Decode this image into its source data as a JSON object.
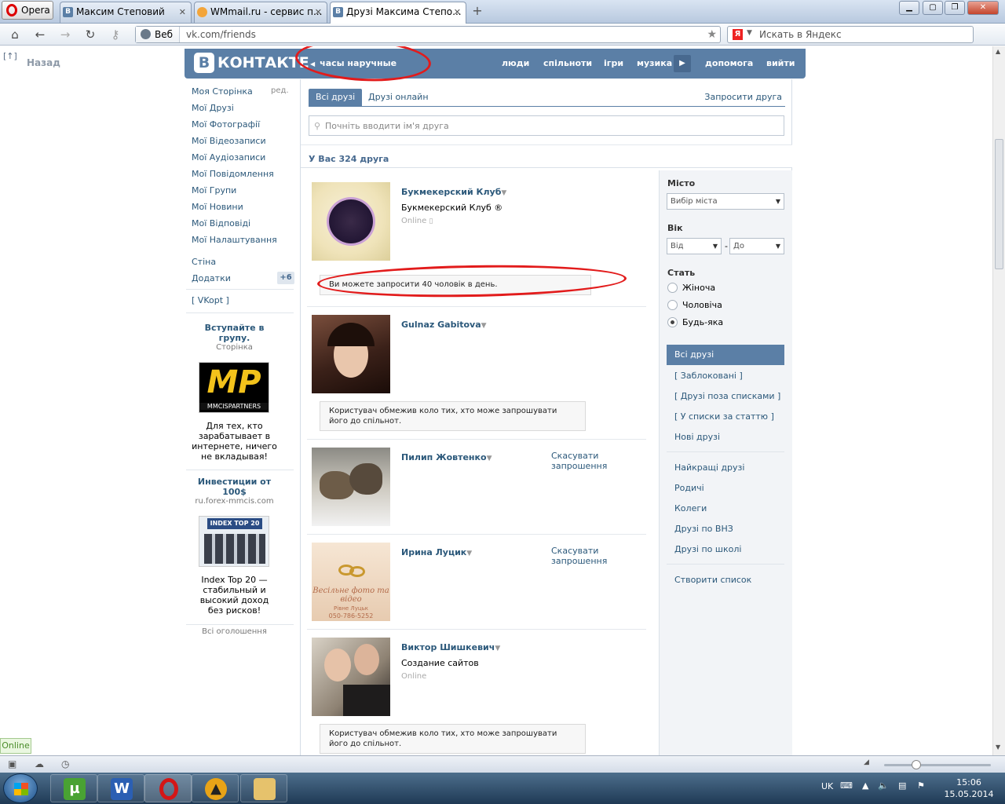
{
  "browser": {
    "opera_label": "Opera",
    "tabs": [
      {
        "label": "Максим Степовий"
      },
      {
        "label": "WMmail.ru - сервис п..."
      },
      {
        "label": "Друзі Максима Степо..."
      }
    ],
    "web_label": "Веб",
    "url": "vk.com/friends",
    "search_placeholder": "Искать в Яндекс",
    "back_label": "Назад",
    "back_icon_label": "[↑]"
  },
  "vk": {
    "logo_letter": "В",
    "logo_text": "КОНТАКТЕ",
    "header_search": "часы наручные",
    "nav": [
      "люди",
      "спільноти",
      "ігри",
      "музика",
      "допомога",
      "вийти"
    ],
    "left_menu": [
      "Моя Сторінка",
      "Мої Друзі",
      "Мої Фотографії",
      "Мої Відеозаписи",
      "Мої Аудіозаписи",
      "Мої Повідомлення",
      "Мої Групи",
      "Мої Новини",
      "Мої Відповіді",
      "Мої Налаштування"
    ],
    "edit_label": "ред.",
    "wall_label": "Стіна",
    "apps_label": "Додатки",
    "apps_badge": "+6",
    "vkopt_label": "[ VKopt ]",
    "ads": [
      {
        "title": "Вступайте в групу.",
        "subtitle": "Сторінка",
        "image_text": "MP",
        "image_caption": "MMCISPARTNERS",
        "desc": "Для тех, кто зарабатывает в интернете, ничего не вкладывая!"
      },
      {
        "title": "Инвестиции от 100$",
        "subtitle": "ru.forex-mmcis.com",
        "image_text": "INDEX TOP 20",
        "desc": "Index Top 20 — стабильный и высокий доход без рисков!"
      }
    ],
    "ads_all": "Всі оголошення",
    "tabs": [
      "Всі друзі",
      "Друзі онлайн"
    ],
    "invite_friend": "Запросити друга",
    "friend_search_placeholder": "Почніть вводити ім'я друга",
    "friends_count": "У Вас 324 друга",
    "friends": [
      {
        "name": "Букмекерский Клуб",
        "sub": "Букмекерский Клуб ®",
        "online": "Online"
      },
      {
        "name": "Gulnaz Gabitova"
      },
      {
        "name": "Пилип Жовтенко",
        "cancel": "Скасувати запрошення"
      },
      {
        "name": "Ирина Луцик",
        "cancel": "Скасувати запрошення",
        "photo_text": "Весільне фото та відео",
        "photo_sub": "Рівне Луцьк",
        "photo_phone": "050-786-5252"
      },
      {
        "name": "Виктор Шишкевич",
        "sub": "Создание сайтов",
        "online": "Online"
      }
    ],
    "notice_limit": "Ви можете запросити 40 чоловік в день.",
    "notice_restricted": "Користувач обмежив коло тих, хто може запрошувати його до спільнот.",
    "filters": {
      "city_label": "Місто",
      "city_placeholder": "Вибір міста",
      "age_label": "Вік",
      "age_from": "Від",
      "age_to": "До",
      "age_dash": "-",
      "gender_label": "Стать",
      "genders": [
        "Жіноча",
        "Чоловіча",
        "Будь-яка"
      ],
      "lists": [
        "Всі друзі",
        "[ Заблоковані ]",
        "[ Друзі поза списками ]",
        "[ У списки за статтю ]",
        "Нові друзі"
      ],
      "groups": [
        "Найкращі друзі",
        "Родичі",
        "Колеги",
        "Друзі по ВНЗ",
        "Друзі по школі"
      ],
      "create_list": "Створити список"
    }
  },
  "status": {
    "online": "Online"
  },
  "taskbar": {
    "lang": "UK",
    "time": "15:06",
    "date": "15.05.2014"
  },
  "colors": {
    "vk_blue": "#5b7fa6",
    "link": "#2b587a",
    "annotation": "#e21b1b"
  }
}
